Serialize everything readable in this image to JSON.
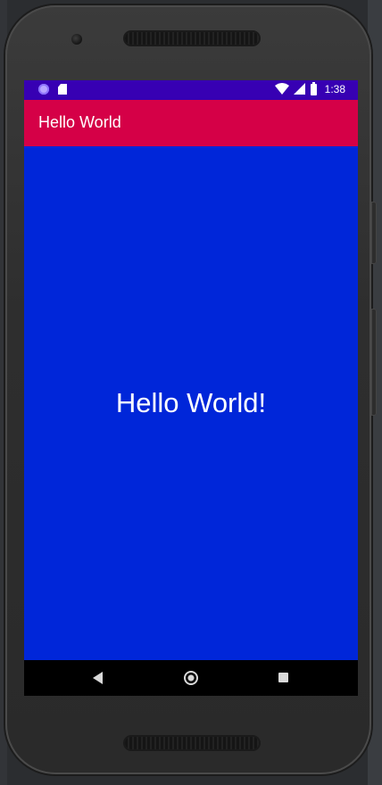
{
  "status_bar": {
    "time": "1:38",
    "notification_icons": [
      "notification-circle-icon",
      "sd-card-icon"
    ],
    "system_icons": [
      "wifi-icon",
      "signal-icon",
      "battery-icon"
    ],
    "background_color": "#3700b3"
  },
  "app_bar": {
    "title": "Hello World",
    "background_color": "#d50047"
  },
  "main": {
    "message": "Hello World!",
    "background_color": "#0026d9"
  },
  "nav_bar": {
    "buttons": [
      "back-icon",
      "home-icon",
      "recents-icon"
    ]
  }
}
